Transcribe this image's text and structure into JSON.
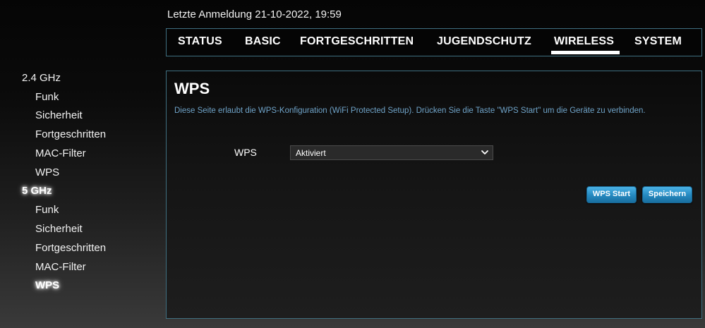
{
  "header": {
    "last_login": "Letzte Anmeldung 21-10-2022, 19:59"
  },
  "nav": {
    "tabs": [
      {
        "label": "STATUS",
        "active": false
      },
      {
        "label": "BASIC",
        "active": false
      },
      {
        "label": "FORTGESCHRITTEN",
        "active": false
      },
      {
        "label": "JUGENDSCHUTZ",
        "active": false
      },
      {
        "label": "WIRELESS",
        "active": true
      },
      {
        "label": "SYSTEM",
        "active": false
      }
    ]
  },
  "sidebar": {
    "band_24": {
      "label": "2.4 GHz",
      "items": [
        "Funk",
        "Sicherheit",
        "Fortgeschritten",
        "MAC-Filter",
        "WPS"
      ]
    },
    "band_5": {
      "label": "5 GHz",
      "items": [
        "Funk",
        "Sicherheit",
        "Fortgeschritten",
        "MAC-Filter",
        "WPS"
      ],
      "active_item": "WPS"
    }
  },
  "panel": {
    "title": "WPS",
    "description": "Diese Seite erlaubt die WPS-Konfiguration (WiFi Protected Setup). Drücken Sie die Taste \"WPS Start\" um die Geräte zu verbinden.",
    "wps_label": "WPS",
    "wps_value": "Aktiviert",
    "buttons": {
      "start": "WPS Start",
      "save": "Speichern"
    }
  },
  "colors": {
    "accent_border": "#3f6f80",
    "description_text": "#6fa3c8",
    "button_blue": "#2488bf"
  },
  "icons": {
    "select_arrow": "chevron-down-icon"
  }
}
